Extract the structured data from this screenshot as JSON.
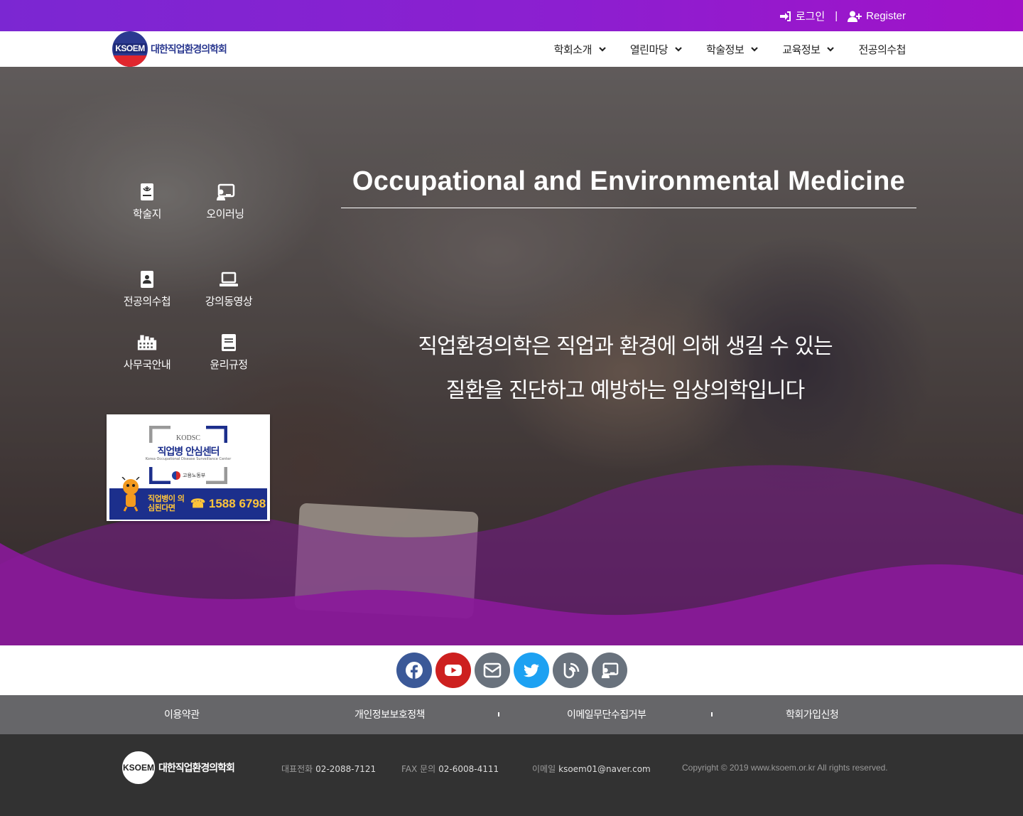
{
  "topbar": {
    "login_label": "로그인",
    "separator": "|",
    "register_label": "Register"
  },
  "header": {
    "logo_badge_text": "KSOEM",
    "logo_name": "대한직업환경의학회",
    "nav": [
      {
        "label": "학회소개",
        "has_dropdown": true
      },
      {
        "label": "열린마당",
        "has_dropdown": true
      },
      {
        "label": "학술정보",
        "has_dropdown": true
      },
      {
        "label": "교육정보",
        "has_dropdown": true
      },
      {
        "label": "전공의수첩",
        "has_dropdown": false
      }
    ]
  },
  "hero": {
    "title": "Occupational and Environmental Medicine",
    "subtitle_line1": "직업환경의학은 직업과 환경에 의해 생길 수 있는",
    "subtitle_line2": "질환을 진단하고 예방하는 임상의학입니다",
    "quick_links": [
      {
        "label": "학술지",
        "icon": "journal-icon"
      },
      {
        "label": "오이러닝",
        "icon": "e-learning-icon"
      },
      {
        "label": "전공의수첩",
        "icon": "resident-handbook-icon"
      },
      {
        "label": "강의동영상",
        "icon": "laptop-icon"
      },
      {
        "label": "사무국안내",
        "icon": "building-icon"
      },
      {
        "label": "윤리규정",
        "icon": "book-icon"
      }
    ],
    "banner": {
      "org": "KODSC",
      "title": "직업병 안심센터",
      "subtitle": "Korea Occupational Disease Surveillance Center",
      "ministry": "고용노동부",
      "cta": "직업병이 의심된다면",
      "phone": "☎ 1588 6798"
    }
  },
  "social": [
    {
      "name": "facebook-icon",
      "color": "#3b5998"
    },
    {
      "name": "youtube-icon",
      "color": "#cd201f"
    },
    {
      "name": "email-icon",
      "color": "#69727d"
    },
    {
      "name": "twitter-icon",
      "color": "#1da1f2"
    },
    {
      "name": "blog-icon",
      "color": "#69727d"
    },
    {
      "name": "e-learning-icon",
      "color": "#69727d"
    }
  ],
  "footer_links": [
    "이용약관",
    "개인정보보호정책",
    "이메일무단수집거부",
    "학회가입신청"
  ],
  "footer": {
    "logo_badge_text": "KSOEM",
    "logo_name": "대한직업환경의학회",
    "phone_label": "대표전화",
    "phone": "02-2088-7121",
    "fax_label": "FAX 문의",
    "fax": "02-6008-4111",
    "email_label": "이메일",
    "email": "ksoem01@naver.com",
    "copyright": "Copyright © 2019 www.ksoem.or.kr All rights reserved."
  },
  "colors": {
    "topbar_start": "#7b27d2",
    "topbar_end": "#a112c8",
    "wave": "#8a1a9a",
    "brand_blue": "#2b3990",
    "footer_links_bg": "#666669",
    "footer_bg": "#323232"
  }
}
